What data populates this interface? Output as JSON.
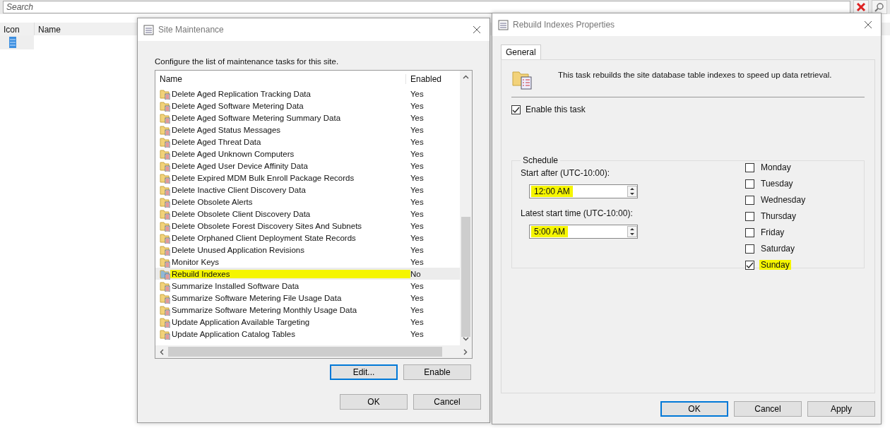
{
  "main": {
    "search": {
      "placeholder": "Search"
    },
    "columns": [
      "Icon",
      "Name"
    ]
  },
  "site_maintenance": {
    "title": "Site Maintenance",
    "intro": "Configure the list of maintenance tasks for this site.",
    "columns": [
      "Name",
      "Enabled"
    ],
    "rows": [
      {
        "name": "Delete Aged Replication Tracking Data",
        "enabled": "Yes",
        "selected": false,
        "highlighted": false
      },
      {
        "name": "Delete Aged Software Metering Data",
        "enabled": "Yes",
        "selected": false,
        "highlighted": false
      },
      {
        "name": "Delete Aged Software Metering Summary Data",
        "enabled": "Yes",
        "selected": false,
        "highlighted": false
      },
      {
        "name": "Delete Aged Status Messages",
        "enabled": "Yes",
        "selected": false,
        "highlighted": false
      },
      {
        "name": "Delete Aged Threat Data",
        "enabled": "Yes",
        "selected": false,
        "highlighted": false
      },
      {
        "name": "Delete Aged Unknown Computers",
        "enabled": "Yes",
        "selected": false,
        "highlighted": false
      },
      {
        "name": "Delete Aged User Device Affinity Data",
        "enabled": "Yes",
        "selected": false,
        "highlighted": false
      },
      {
        "name": "Delete Expired MDM Bulk Enroll Package Records",
        "enabled": "Yes",
        "selected": false,
        "highlighted": false
      },
      {
        "name": "Delete Inactive Client Discovery Data",
        "enabled": "Yes",
        "selected": false,
        "highlighted": false
      },
      {
        "name": "Delete Obsolete Alerts",
        "enabled": "Yes",
        "selected": false,
        "highlighted": false
      },
      {
        "name": "Delete Obsolete Client Discovery Data",
        "enabled": "Yes",
        "selected": false,
        "highlighted": false
      },
      {
        "name": "Delete Obsolete Forest Discovery Sites And Subnets",
        "enabled": "Yes",
        "selected": false,
        "highlighted": false
      },
      {
        "name": "Delete Orphaned Client Deployment State Records",
        "enabled": "Yes",
        "selected": false,
        "highlighted": false
      },
      {
        "name": "Delete Unused Application Revisions",
        "enabled": "Yes",
        "selected": false,
        "highlighted": false
      },
      {
        "name": "Monitor Keys",
        "enabled": "Yes",
        "selected": false,
        "highlighted": false
      },
      {
        "name": "Rebuild Indexes",
        "enabled": "No",
        "selected": true,
        "highlighted": true
      },
      {
        "name": "Summarize Installed Software Data",
        "enabled": "Yes",
        "selected": false,
        "highlighted": false
      },
      {
        "name": "Summarize Software Metering File Usage Data",
        "enabled": "Yes",
        "selected": false,
        "highlighted": false
      },
      {
        "name": "Summarize Software Metering Monthly Usage Data",
        "enabled": "Yes",
        "selected": false,
        "highlighted": false
      },
      {
        "name": "Update Application Available Targeting",
        "enabled": "Yes",
        "selected": false,
        "highlighted": false
      },
      {
        "name": "Update Application Catalog Tables",
        "enabled": "Yes",
        "selected": false,
        "highlighted": false
      }
    ],
    "buttons": [
      "Edit...",
      "Enable"
    ],
    "footer_buttons": [
      "OK",
      "Cancel"
    ]
  },
  "properties": {
    "title": "Rebuild Indexes Properties",
    "tabs": [
      {
        "label": "General",
        "selected": true
      }
    ],
    "description": "This task rebuilds the site database table indexes to speed up data retrieval.",
    "enable": {
      "label": "Enable this task",
      "checked": true
    },
    "schedule": {
      "title": "Schedule",
      "fields": [
        {
          "label": "Start after (UTC-10:00):",
          "value": "12:00 AM",
          "highlighted": true
        },
        {
          "label": "Latest start time (UTC-10:00):",
          "value": "5:00 AM",
          "highlighted": true
        }
      ],
      "days": [
        {
          "label": "Monday",
          "checked": false,
          "highlighted": false
        },
        {
          "label": "Tuesday",
          "checked": false,
          "highlighted": false
        },
        {
          "label": "Wednesday",
          "checked": false,
          "highlighted": false
        },
        {
          "label": "Thursday",
          "checked": false,
          "highlighted": false
        },
        {
          "label": "Friday",
          "checked": false,
          "highlighted": false
        },
        {
          "label": "Saturday",
          "checked": false,
          "highlighted": false
        },
        {
          "label": "Sunday",
          "checked": true,
          "highlighted": true
        }
      ]
    },
    "buttons": [
      "OK",
      "Cancel",
      "Apply"
    ]
  }
}
